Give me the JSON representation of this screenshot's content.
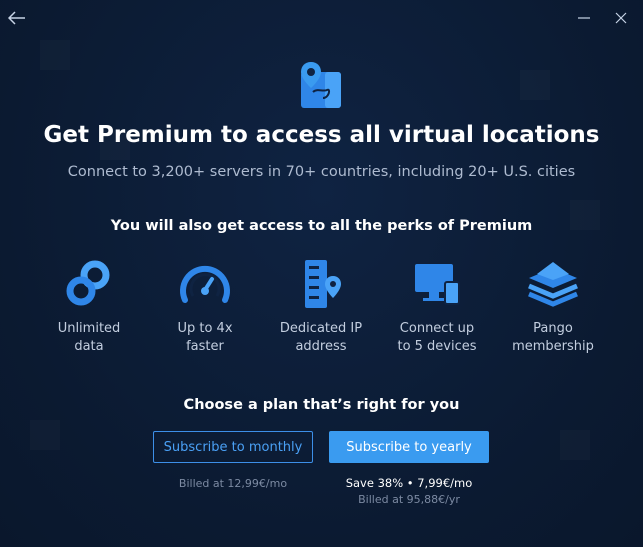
{
  "titlebar": {
    "back_icon": "arrow-left-icon",
    "minimize_icon": "minimize-icon",
    "close_icon": "close-icon"
  },
  "hero": {
    "icon": "map-pin-route-icon",
    "title": "Get Premium to access all virtual locations",
    "subtitle": "Connect to 3,200+ servers in 70+ countries, including 20+ U.S. cities"
  },
  "perks": {
    "heading": "You will also get access to all the perks of Premium",
    "items": [
      {
        "icon": "infinity-link-icon",
        "label": "Unlimited\ndata"
      },
      {
        "icon": "speedometer-icon",
        "label": "Up to 4x\nfaster"
      },
      {
        "icon": "server-location-icon",
        "label": "Dedicated IP\naddress"
      },
      {
        "icon": "devices-icon",
        "label": "Connect up\nto 5 devices"
      },
      {
        "icon": "layers-icon",
        "label": "Pango\nmembership"
      }
    ]
  },
  "plans": {
    "heading": "Choose a plan that’s right for you",
    "monthly": {
      "button_label": "Subscribe to monthly",
      "billed": "Billed at 12,99€/mo"
    },
    "yearly": {
      "button_label": "Subscribe to yearly",
      "save": "Save 38% • 7,99€/mo",
      "billed": "Billed at 95,88€/yr"
    }
  },
  "colors": {
    "background": "#0c1b33",
    "accent": "#3a9bf0",
    "icon_blue": "#2f86e8"
  }
}
